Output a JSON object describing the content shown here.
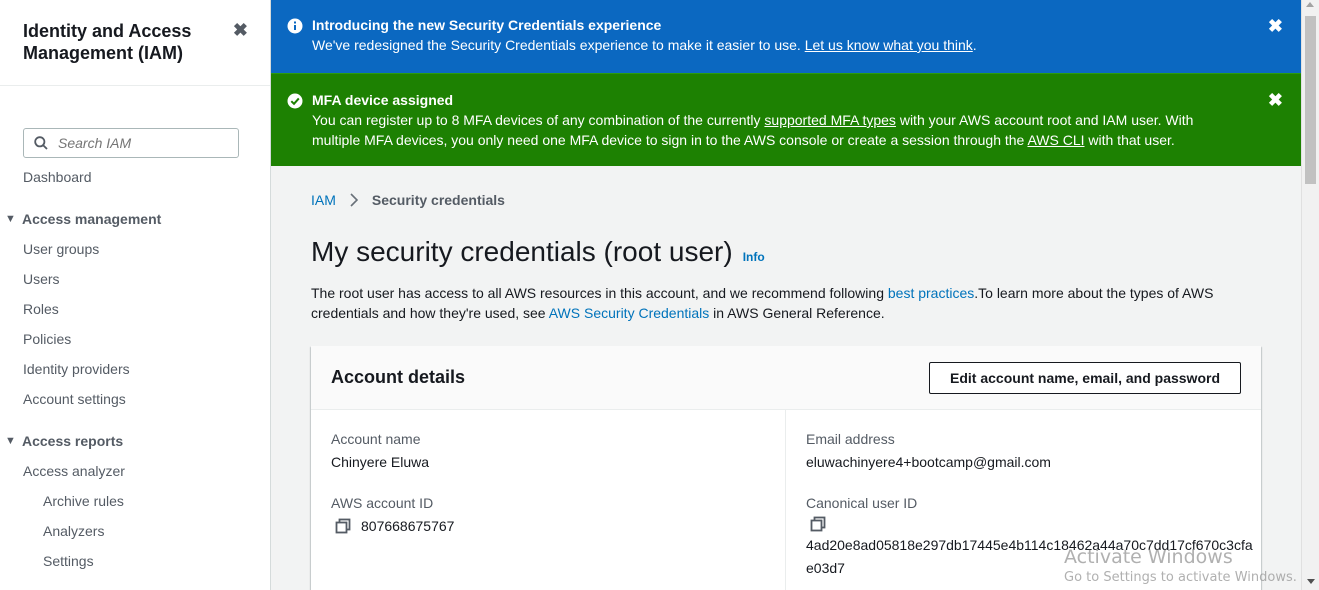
{
  "sidebar": {
    "title": "Identity and Access Management (IAM)",
    "close_icon": "✖",
    "search_placeholder": "Search IAM",
    "dashboard": "Dashboard",
    "sections": [
      {
        "title": "Access management",
        "items": [
          "User groups",
          "Users",
          "Roles",
          "Policies",
          "Identity providers",
          "Account settings"
        ]
      },
      {
        "title": "Access reports",
        "items": [
          "Access analyzer"
        ],
        "subitems": [
          "Archive rules",
          "Analyzers",
          "Settings"
        ]
      }
    ]
  },
  "flash_info": {
    "title": "Introducing the new Security Credentials experience",
    "text": "We've redesigned the Security Credentials experience to make it easier to use.",
    "link": "Let us know what you think",
    "suffix": "."
  },
  "flash_success": {
    "title": "MFA device assigned",
    "text_1": "You can register up to 8 MFA devices of any combination of the currently",
    "link_1": "supported MFA types",
    "text_2": "with your AWS account root and IAM user. With multiple MFA devices, you only need one MFA device to sign in to the AWS console or create a session through the",
    "link_2": "AWS CLI",
    "text_3": "with that user."
  },
  "breadcrumb": {
    "root": "IAM",
    "current": "Security credentials"
  },
  "page": {
    "title": "My security credentials (root user)",
    "info": "Info",
    "desc_1": "The root user has access to all AWS resources in this account, and we recommend following",
    "desc_link_1": "best practices",
    "desc_2": ".To learn more about the types of AWS credentials and how they're used, see",
    "desc_link_2": "AWS Security Credentials",
    "desc_3": "in AWS General Reference."
  },
  "account_details": {
    "heading": "Account details",
    "edit_button": "Edit account name, email, and password",
    "account_name_label": "Account name",
    "account_name": "Chinyere Eluwa",
    "account_id_label": "AWS account ID",
    "account_id": "807668675767",
    "email_label": "Email address",
    "email": "eluwachinyere4+bootcamp@gmail.com",
    "canonical_label": "Canonical user ID",
    "canonical_id": "4ad20e8ad05818e297db17445e4b114c18462a44a70c7dd17cf670c3cfae03d7"
  },
  "watermark": {
    "line1": "Activate Windows",
    "line2": "Go to Settings to activate Windows."
  },
  "colors": {
    "info_blue": "#0b68c1",
    "success_green": "#1d8102",
    "link_blue": "#0073bb"
  }
}
